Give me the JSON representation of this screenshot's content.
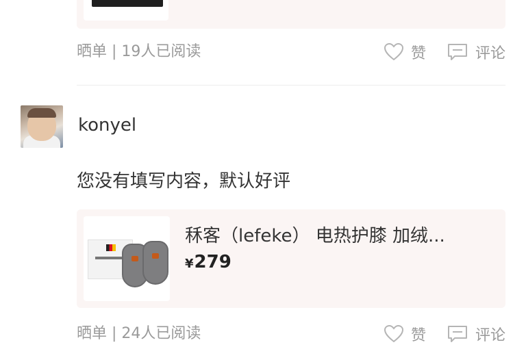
{
  "previous_review": {
    "meta": "晒单 | 19人已阅读",
    "like_label": "赞",
    "comment_label": "评论"
  },
  "review": {
    "username": "konyel",
    "text": "您没有填写内容，默认好评",
    "product": {
      "title": "秝客（lefeke） 电热护膝 加绒...",
      "currency": "¥",
      "price": "279"
    },
    "meta": "晒单 | 24人已阅读",
    "like_label": "赞",
    "comment_label": "评论"
  },
  "icons": {
    "like": "heart-outline-icon",
    "comment": "comment-bubble-icon"
  },
  "colors": {
    "muted_text": "#9a9a9a",
    "card_bg": "#fbf5f4",
    "primary_text": "#333333"
  }
}
